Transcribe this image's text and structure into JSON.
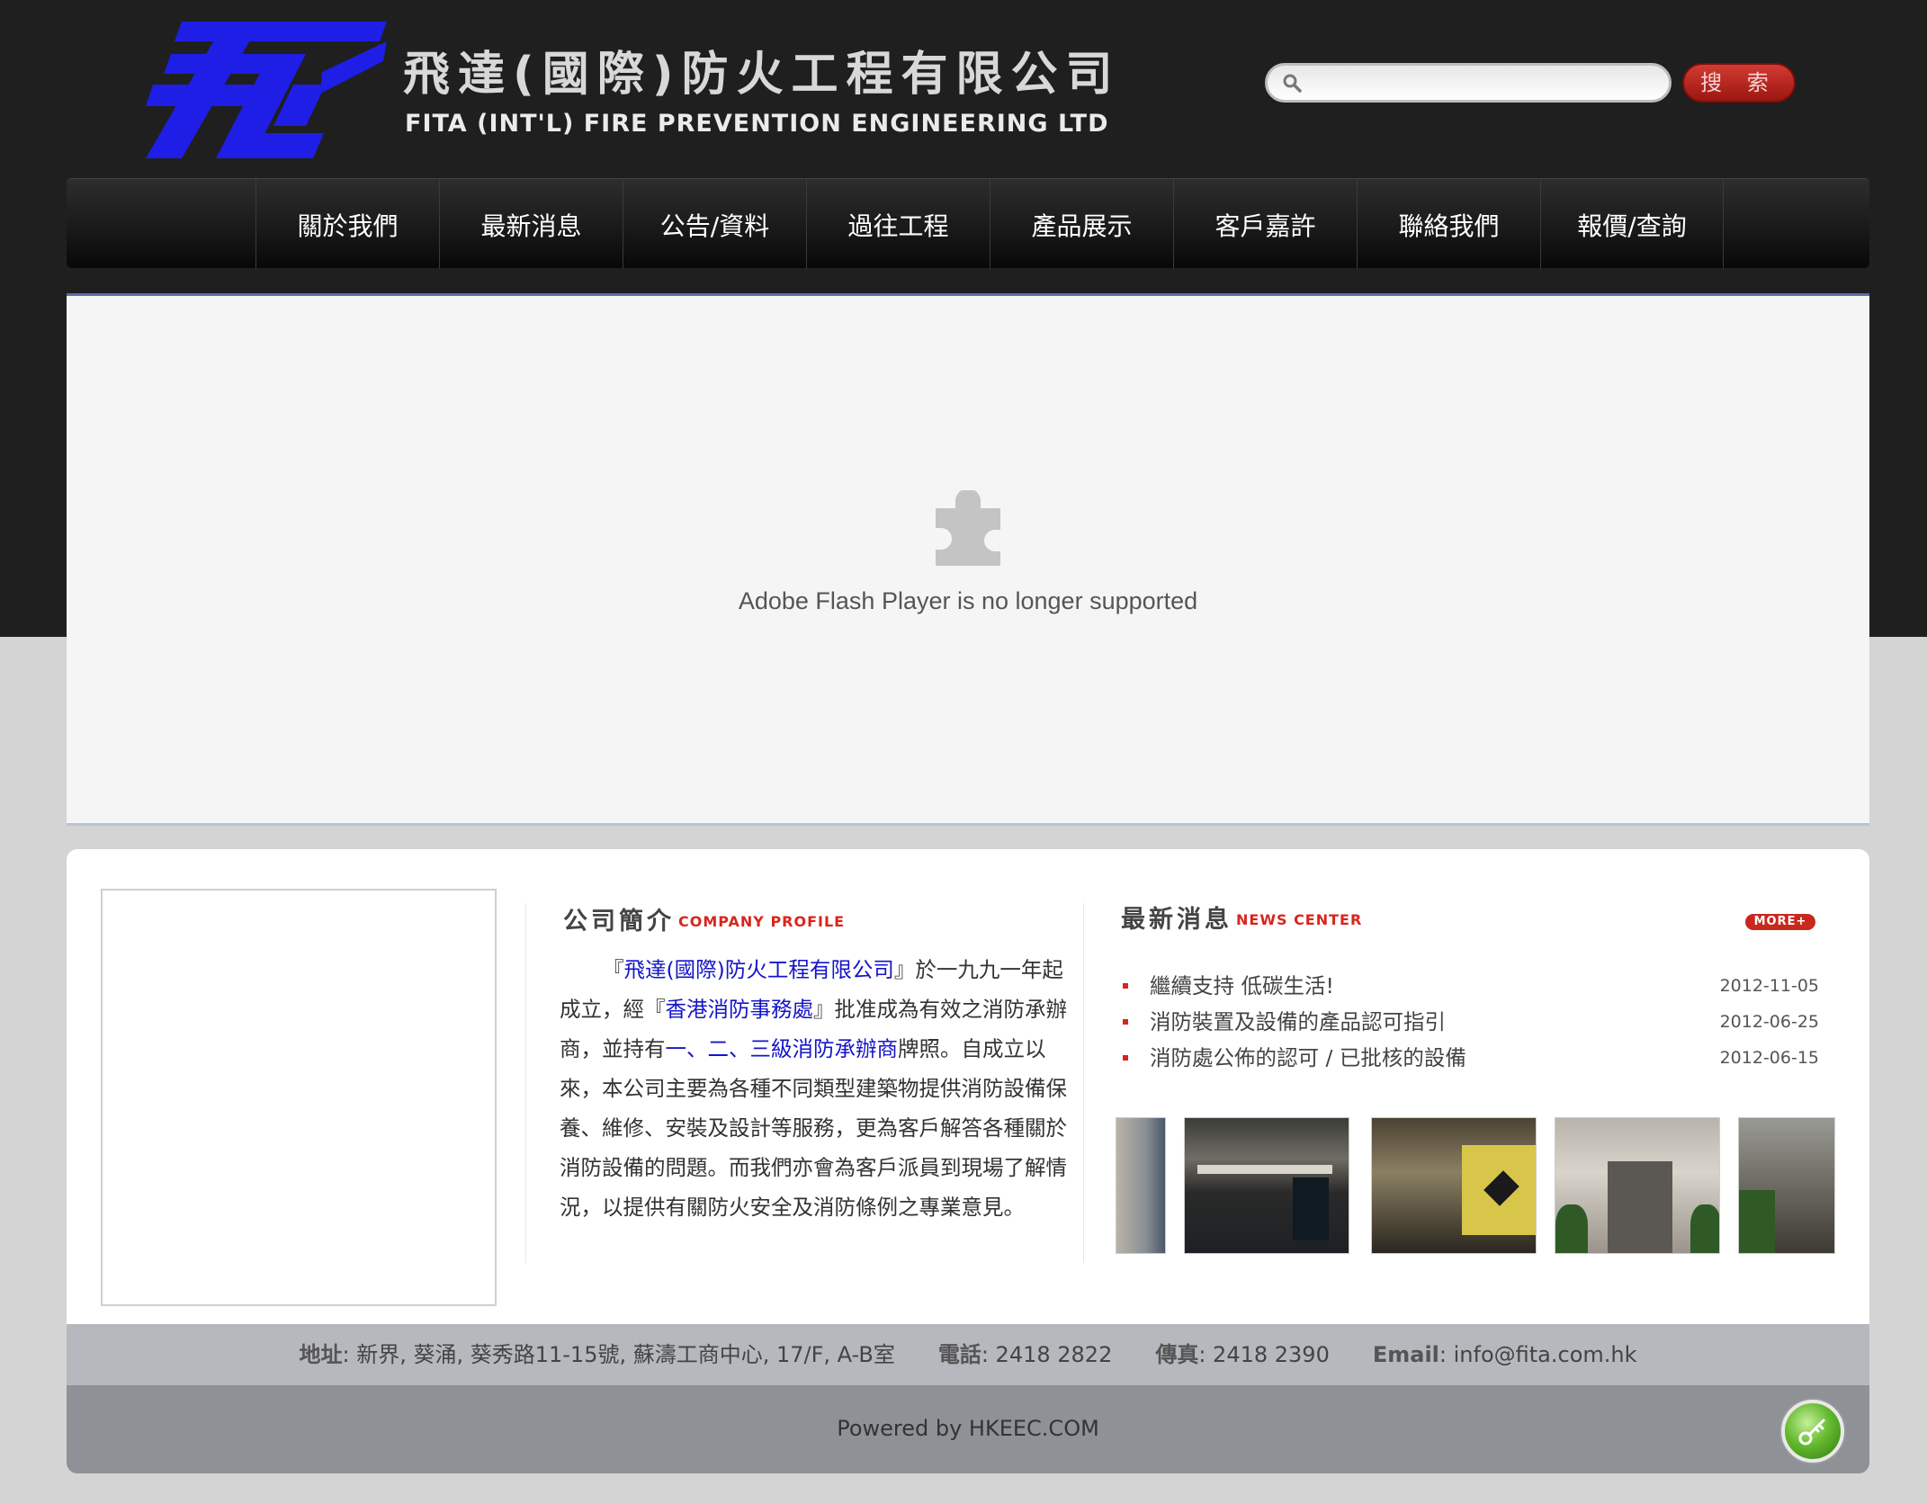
{
  "header": {
    "company_name_cn": "飛達(國際)防火工程有限公司",
    "company_name_en": "FITA (INT'L) FIRE PREVENTION ENGINEERING LTD",
    "logo_color": "#1e1ee6",
    "search": {
      "value": "",
      "button_label": "搜 索"
    }
  },
  "nav": {
    "items": [
      {
        "label": "關於我們"
      },
      {
        "label": "最新消息"
      },
      {
        "label": "公告/資料"
      },
      {
        "label": "過往工程"
      },
      {
        "label": "產品展示"
      },
      {
        "label": "客戶嘉許"
      },
      {
        "label": "聯絡我們"
      },
      {
        "label": "報價/查詢"
      }
    ]
  },
  "flash": {
    "icon": "plugin-icon",
    "message": "Adobe Flash Player is no longer supported"
  },
  "profile": {
    "title_cn": "公司簡介",
    "title_en": "COMPANY PROFILE",
    "parts": {
      "p1": "『",
      "p2": "飛達(國際)防火工程有限公司",
      "p3": "』於一九九一年起成立，經『",
      "p4": "香港消防事務處",
      "p5": "』批准成為有效之消防承辦商，並持有",
      "p6": "一、二、三級消防承辦商",
      "p7": "牌照。自成立以來，本公司主要為各種不同類型建築物提供消防設備保養、維修、安裝及設計等服務，更為客戶解答各種關於消防設備的問題。而我們亦會為客戶派員到現場了解情況，以提供有關防火安全及消防條例之專業意見。"
    }
  },
  "news": {
    "title_cn": "最新消息",
    "title_en": "NEWS CENTER",
    "more_label": "MORE+",
    "items": [
      {
        "title": "繼續支持 低碳生活!",
        "date": "2012-11-05"
      },
      {
        "title": "消防裝置及設備的產品認可指引",
        "date": "2012-06-25"
      },
      {
        "title": "消防處公佈的認可 / 已批核的設備",
        "date": "2012-06-15"
      }
    ]
  },
  "footer": {
    "address_label": "地址",
    "address": ": 新界, 葵涌, 葵秀路11-15號, 蘇濤工商中心, 17/F, A-B室",
    "phone_label": "電話",
    "phone": ": 2418 2822",
    "fax_label": "傳真",
    "fax": ": 2418 2390",
    "email_label": "Email",
    "email": ": info@fita.com.hk",
    "powered": "Powered by HKEEC.COM"
  }
}
